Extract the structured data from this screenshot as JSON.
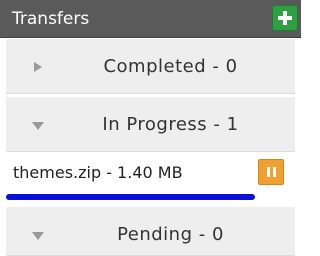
{
  "header": {
    "title": "Transfers",
    "add_icon": "plus-icon"
  },
  "sections": {
    "completed": {
      "label": "Completed - 0",
      "expanded": false
    },
    "in_progress": {
      "label": "In Progress - 1",
      "expanded": true
    },
    "pending": {
      "label": "Pending - 0",
      "expanded": true
    }
  },
  "transfer": {
    "name": "themes.zip - 1.40 MB",
    "progress_fraction": 0.86,
    "action_icon": "pause-icon"
  },
  "colors": {
    "header_bg": "#5a5a5a",
    "add_button": "#2ea043",
    "pause_button": "#f0a030",
    "progress_fill": "#0a10d8"
  }
}
